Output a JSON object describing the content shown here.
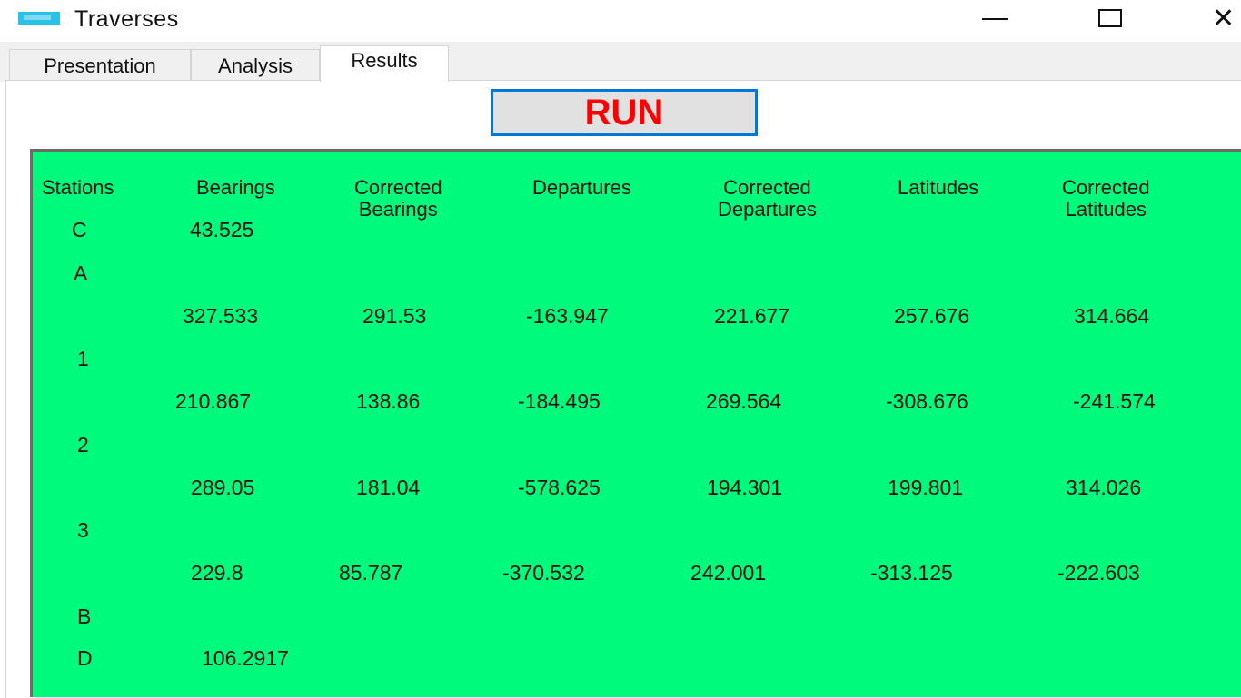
{
  "window": {
    "title": "Traverses"
  },
  "tabs": [
    {
      "label": "Presentation"
    },
    {
      "label": "Analysis"
    },
    {
      "label": "Results"
    }
  ],
  "run_button": {
    "label": "RUN"
  },
  "results": {
    "headers": {
      "stations": "Stations",
      "bearings": "Bearings",
      "corrected_bearings": "Corrected\nBearings",
      "departures": "Departures",
      "corrected_departures": "Corrected\nDepartures",
      "latitudes": "Latitudes",
      "corrected_latitudes": "Corrected\nLatitudes"
    },
    "stations": [
      "C",
      "A",
      "1",
      "2",
      "3",
      "B",
      "D"
    ],
    "station_values": {
      "C_bearing": "43.525",
      "D_bearing": "106.2917"
    },
    "legs": [
      {
        "bearing": "327.533",
        "corrected_bearing": "291.53",
        "departure": "-163.947",
        "corrected_departure": "221.677",
        "latitude": "257.676",
        "corrected_latitude": "314.664"
      },
      {
        "bearing": "210.867",
        "corrected_bearing": "138.86",
        "departure": "-184.495",
        "corrected_departure": "269.564",
        "latitude": "-308.676",
        "corrected_latitude": "-241.574"
      },
      {
        "bearing": "289.05",
        "corrected_bearing": "181.04",
        "departure": "-578.625",
        "corrected_departure": "194.301",
        "latitude": "199.801",
        "corrected_latitude": "314.026"
      },
      {
        "bearing": "229.8",
        "corrected_bearing": "85.787",
        "departure": "-370.532",
        "corrected_departure": "242.001",
        "latitude": "-313.125",
        "corrected_latitude": "-222.603"
      }
    ]
  },
  "colors": {
    "results_background": "#00fb7c",
    "run_text": "#ff0000",
    "run_border": "#0078d7"
  }
}
